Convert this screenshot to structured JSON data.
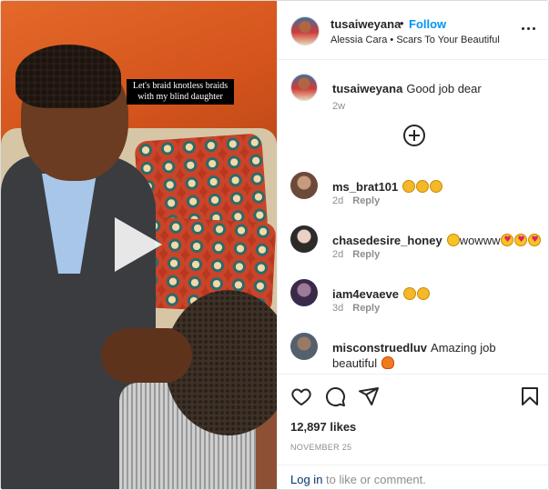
{
  "media": {
    "caption_line1": "Let's braid knotless braids",
    "caption_line2": "with my blind daughter"
  },
  "header": {
    "username": "tusaiweyana",
    "separator": "•",
    "follow_label": "Follow",
    "music": "Alessia Cara • Scars To Your Beautiful",
    "more_icon": "more-horizontal-icon"
  },
  "owner_comment": {
    "username": "tusaiweyana",
    "text": "Good job dear",
    "time": "2w"
  },
  "load_more_icon": "plus-circle-icon",
  "comments": [
    {
      "username": "ms_brat101",
      "emojis": [
        "clap",
        "clap",
        "clap"
      ],
      "text": "",
      "time": "2d",
      "reply": "Reply"
    },
    {
      "username": "chasedesire_honey",
      "emojis_before": [
        "wow"
      ],
      "text": "wowww",
      "emojis": [
        "heart",
        "heart",
        "heart"
      ],
      "time": "2d",
      "reply": "Reply"
    },
    {
      "username": "iam4evaeve",
      "emojis": [
        "clap",
        "clap"
      ],
      "text": "",
      "time": "3d",
      "reply": "Reply"
    },
    {
      "username": "misconstruedluv",
      "text": "Amazing job beautiful",
      "emojis": [
        "fire"
      ],
      "time": "",
      "reply": ""
    }
  ],
  "actions": {
    "like_icon": "heart-icon",
    "comment_icon": "comment-icon",
    "share_icon": "send-icon",
    "save_icon": "bookmark-icon"
  },
  "likes": "12,897 likes",
  "date": "NOVEMBER 25",
  "footer": {
    "login_label": "Log in",
    "rest": " to like or comment."
  },
  "colors": {
    "link_blue": "#0095f6",
    "login_blue": "#00376b",
    "muted": "#8e8e8e",
    "border": "#efefef"
  }
}
